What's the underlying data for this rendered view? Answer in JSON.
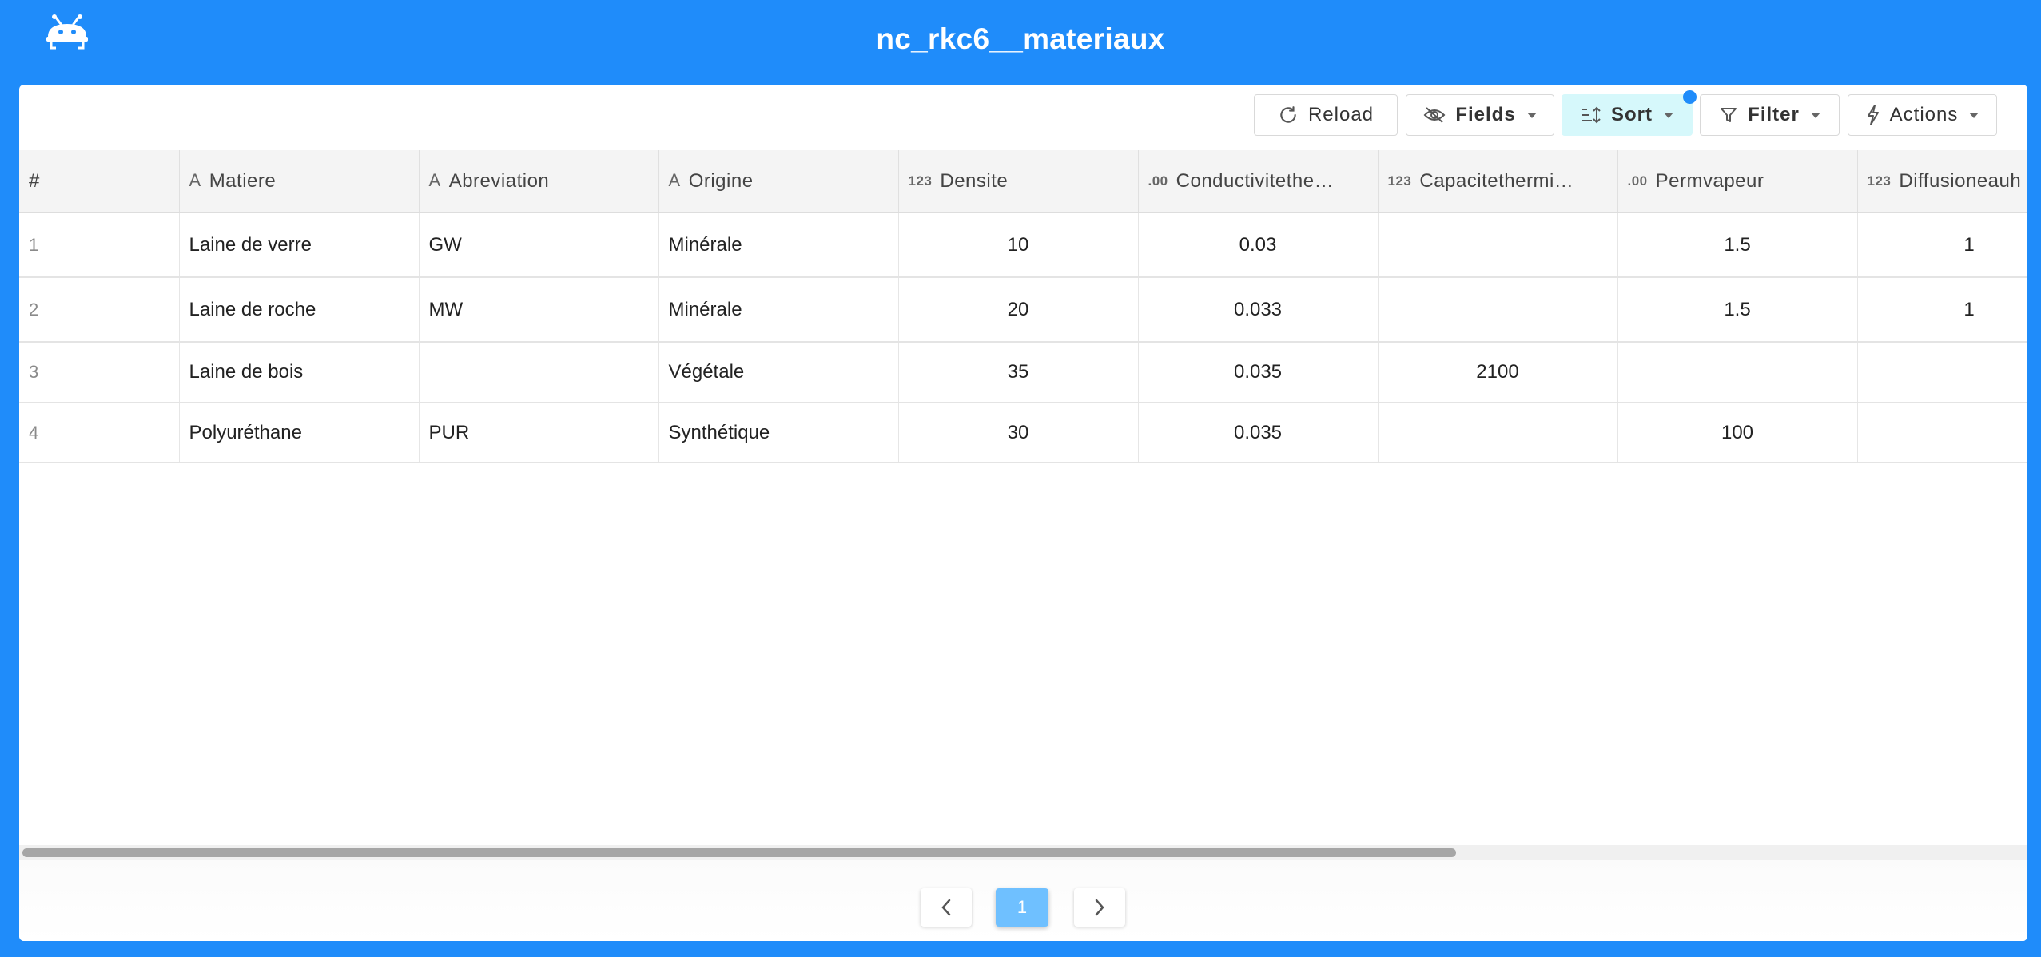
{
  "app": {
    "title": "nc_rkc6__materiaux",
    "logo_icon": "robot-logo-icon"
  },
  "toolbar": {
    "reload_label": "Reload",
    "fields_label": "Fields",
    "sort_label": "Sort",
    "filter_label": "Filter",
    "actions_label": "Actions"
  },
  "table": {
    "columns": [
      {
        "label": "#",
        "type_icon": ""
      },
      {
        "label": "Matiere",
        "type_icon": "A"
      },
      {
        "label": "Abreviation",
        "type_icon": "A"
      },
      {
        "label": "Origine",
        "type_icon": "A"
      },
      {
        "label": "Densite",
        "type_icon": "123"
      },
      {
        "label": "Conductivitethe…",
        "type_icon": ".00"
      },
      {
        "label": "Capacitethermi…",
        "type_icon": "123"
      },
      {
        "label": "Permvapeur",
        "type_icon": ".00"
      },
      {
        "label": "Diffusioneauh",
        "type_icon": "123"
      }
    ],
    "rows": [
      [
        "1",
        "Laine de verre",
        "GW",
        "Minérale",
        "10",
        "0.03",
        "",
        "1.5",
        "1"
      ],
      [
        "2",
        "Laine de roche",
        "MW",
        "Minérale",
        "20",
        "0.033",
        "",
        "1.5",
        "1"
      ],
      [
        "3",
        "Laine de bois",
        "",
        "Végétale",
        "35",
        "0.035",
        "2100",
        "",
        ""
      ],
      [
        "4",
        "Polyuréthane",
        "PUR",
        "Synthétique",
        "30",
        "0.035",
        "",
        "100",
        ""
      ]
    ]
  },
  "pagination": {
    "current_page": "1"
  },
  "colors": {
    "brand": "#1f8cfa",
    "sort_active_bg": "#d6f8fb",
    "page_active": "#6fc0ff"
  }
}
